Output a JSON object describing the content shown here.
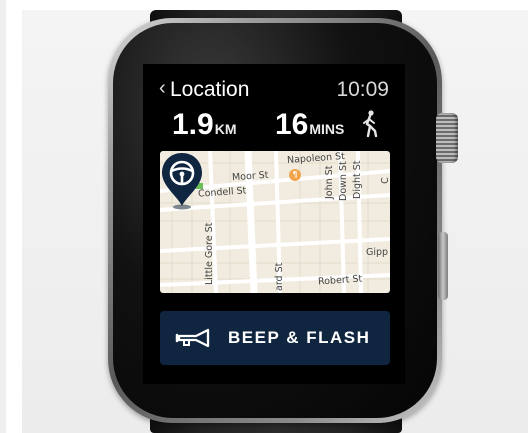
{
  "header": {
    "back_glyph": "‹",
    "title": "Location",
    "time": "10:09"
  },
  "stats": {
    "distance_value": "1.9",
    "distance_unit": "KM",
    "duration_value": "16",
    "duration_unit": "MINS",
    "mode_icon": "walking-person-icon"
  },
  "map": {
    "streets": {
      "napoleon": "Napoleon St",
      "moor": "Moor St",
      "condell": "Condell St",
      "john": "John St",
      "down": "Down St",
      "dight": "Dight St",
      "little_gore": "Little Gore St",
      "gipp": "Gipp",
      "ard": "ard St",
      "robert": "Robert St",
      "cut_c": "C"
    },
    "poi_glyph": "¶",
    "car_icon": "steering-wheel-pin-icon",
    "colors": {
      "background": "#f1ecdf",
      "pin": "#0f2540"
    }
  },
  "action": {
    "label": "BEEP & FLASH",
    "icon": "horn-icon",
    "background": "#0f2540"
  }
}
